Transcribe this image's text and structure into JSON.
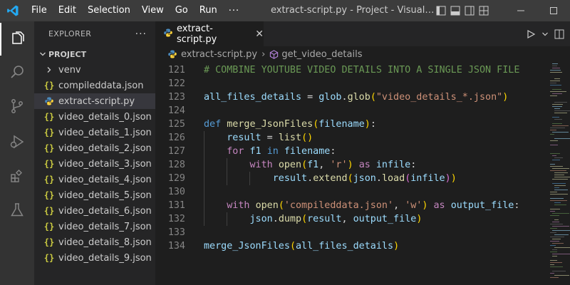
{
  "menu": [
    "File",
    "Edit",
    "Selection",
    "View",
    "Go",
    "Run"
  ],
  "menu_more": "···",
  "window_title": "extract-script.py - Project - Visual Studio Code ...",
  "sidebar": {
    "title": "EXPLORER",
    "more": "···",
    "project": "PROJECT",
    "items": [
      {
        "label": "venv",
        "type": "folder"
      },
      {
        "label": "compileddata.json",
        "type": "json"
      },
      {
        "label": "extract-script.py",
        "type": "python",
        "selected": true
      },
      {
        "label": "video_details_0.json",
        "type": "json"
      },
      {
        "label": "video_details_1.json",
        "type": "json"
      },
      {
        "label": "video_details_2.json",
        "type": "json"
      },
      {
        "label": "video_details_3.json",
        "type": "json"
      },
      {
        "label": "video_details_4.json",
        "type": "json"
      },
      {
        "label": "video_details_5.json",
        "type": "json"
      },
      {
        "label": "video_details_6.json",
        "type": "json"
      },
      {
        "label": "video_details_7.json",
        "type": "json"
      },
      {
        "label": "video_details_8.json",
        "type": "json"
      },
      {
        "label": "video_details_9.json",
        "type": "json"
      }
    ]
  },
  "json_icon_glyph": "{}",
  "tab": {
    "label": "extract-script.py",
    "close": "✕"
  },
  "breadcrumb": {
    "file": "extract-script.py",
    "symbol": "get_video_details"
  },
  "code_lines": [
    {
      "n": "121",
      "indent": 0,
      "tokens": [
        [
          "cm",
          "# COMBINE YOUTUBE VIDEO DETAILS INTO A SINGLE JSON FILE"
        ]
      ]
    },
    {
      "n": "122",
      "indent": 0,
      "tokens": []
    },
    {
      "n": "123",
      "indent": 0,
      "tokens": [
        [
          "var",
          "all_files_details"
        ],
        [
          "pn",
          " = "
        ],
        [
          "var",
          "glob"
        ],
        [
          "pn",
          "."
        ],
        [
          "fn",
          "glob"
        ],
        [
          "br1",
          "("
        ],
        [
          "str",
          "\"video_details_*.json\""
        ],
        [
          "br1",
          ")"
        ]
      ]
    },
    {
      "n": "124",
      "indent": 0,
      "tokens": []
    },
    {
      "n": "125",
      "indent": 0,
      "tokens": [
        [
          "kw",
          "def"
        ],
        [
          "pn",
          " "
        ],
        [
          "fn",
          "merge_JsonFiles"
        ],
        [
          "br1",
          "("
        ],
        [
          "var",
          "filename"
        ],
        [
          "br1",
          ")"
        ],
        [
          "pn",
          ":"
        ]
      ]
    },
    {
      "n": "126",
      "indent": 1,
      "tokens": [
        [
          "var",
          "result"
        ],
        [
          "pn",
          " = "
        ],
        [
          "fn",
          "list"
        ],
        [
          "br1",
          "()"
        ]
      ]
    },
    {
      "n": "127",
      "indent": 1,
      "tokens": [
        [
          "kw2",
          "for"
        ],
        [
          "pn",
          " "
        ],
        [
          "var",
          "f1"
        ],
        [
          "pn",
          " "
        ],
        [
          "kw",
          "in"
        ],
        [
          "pn",
          " "
        ],
        [
          "var",
          "filename"
        ],
        [
          "pn",
          ":"
        ]
      ]
    },
    {
      "n": "128",
      "indent": 2,
      "tokens": [
        [
          "kw2",
          "with"
        ],
        [
          "pn",
          " "
        ],
        [
          "fn",
          "open"
        ],
        [
          "br1",
          "("
        ],
        [
          "var",
          "f1"
        ],
        [
          "pn",
          ", "
        ],
        [
          "str",
          "'r'"
        ],
        [
          "br1",
          ")"
        ],
        [
          "pn",
          " "
        ],
        [
          "kw2",
          "as"
        ],
        [
          "pn",
          " "
        ],
        [
          "var",
          "infile"
        ],
        [
          "pn",
          ":"
        ]
      ]
    },
    {
      "n": "129",
      "indent": 3,
      "tokens": [
        [
          "var",
          "result"
        ],
        [
          "pn",
          "."
        ],
        [
          "fn",
          "extend"
        ],
        [
          "br1",
          "("
        ],
        [
          "var",
          "json"
        ],
        [
          "pn",
          "."
        ],
        [
          "fn",
          "load"
        ],
        [
          "br2",
          "("
        ],
        [
          "var",
          "infile"
        ],
        [
          "br2",
          ")"
        ],
        [
          "br1",
          ")"
        ]
      ]
    },
    {
      "n": "130",
      "indent": 1,
      "tokens": []
    },
    {
      "n": "131",
      "indent": 1,
      "tokens": [
        [
          "kw2",
          "with"
        ],
        [
          "pn",
          " "
        ],
        [
          "fn",
          "open"
        ],
        [
          "br1",
          "("
        ],
        [
          "str",
          "'compileddata.json'"
        ],
        [
          "pn",
          ", "
        ],
        [
          "str",
          "'w'"
        ],
        [
          "br1",
          ")"
        ],
        [
          "pn",
          " "
        ],
        [
          "kw2",
          "as"
        ],
        [
          "pn",
          " "
        ],
        [
          "var",
          "output_file"
        ],
        [
          "pn",
          ":"
        ]
      ]
    },
    {
      "n": "132",
      "indent": 2,
      "tokens": [
        [
          "var",
          "json"
        ],
        [
          "pn",
          "."
        ],
        [
          "fn",
          "dump"
        ],
        [
          "br1",
          "("
        ],
        [
          "var",
          "result"
        ],
        [
          "pn",
          ", "
        ],
        [
          "var",
          "output_file"
        ],
        [
          "br1",
          ")"
        ]
      ]
    },
    {
      "n": "133",
      "indent": 0,
      "tokens": []
    },
    {
      "n": "134",
      "indent": 0,
      "tokens": [
        [
          "var",
          "merge_JsonFiles"
        ],
        [
          "br1",
          "("
        ],
        [
          "var",
          "all_files_details"
        ],
        [
          "br1",
          ")"
        ]
      ]
    }
  ],
  "colors": {
    "titlebar": "#3c3c3c",
    "activitybar": "#333333",
    "sidebar": "#252526",
    "editor": "#1e1e1e",
    "accent_logo": "#23a9f2"
  }
}
